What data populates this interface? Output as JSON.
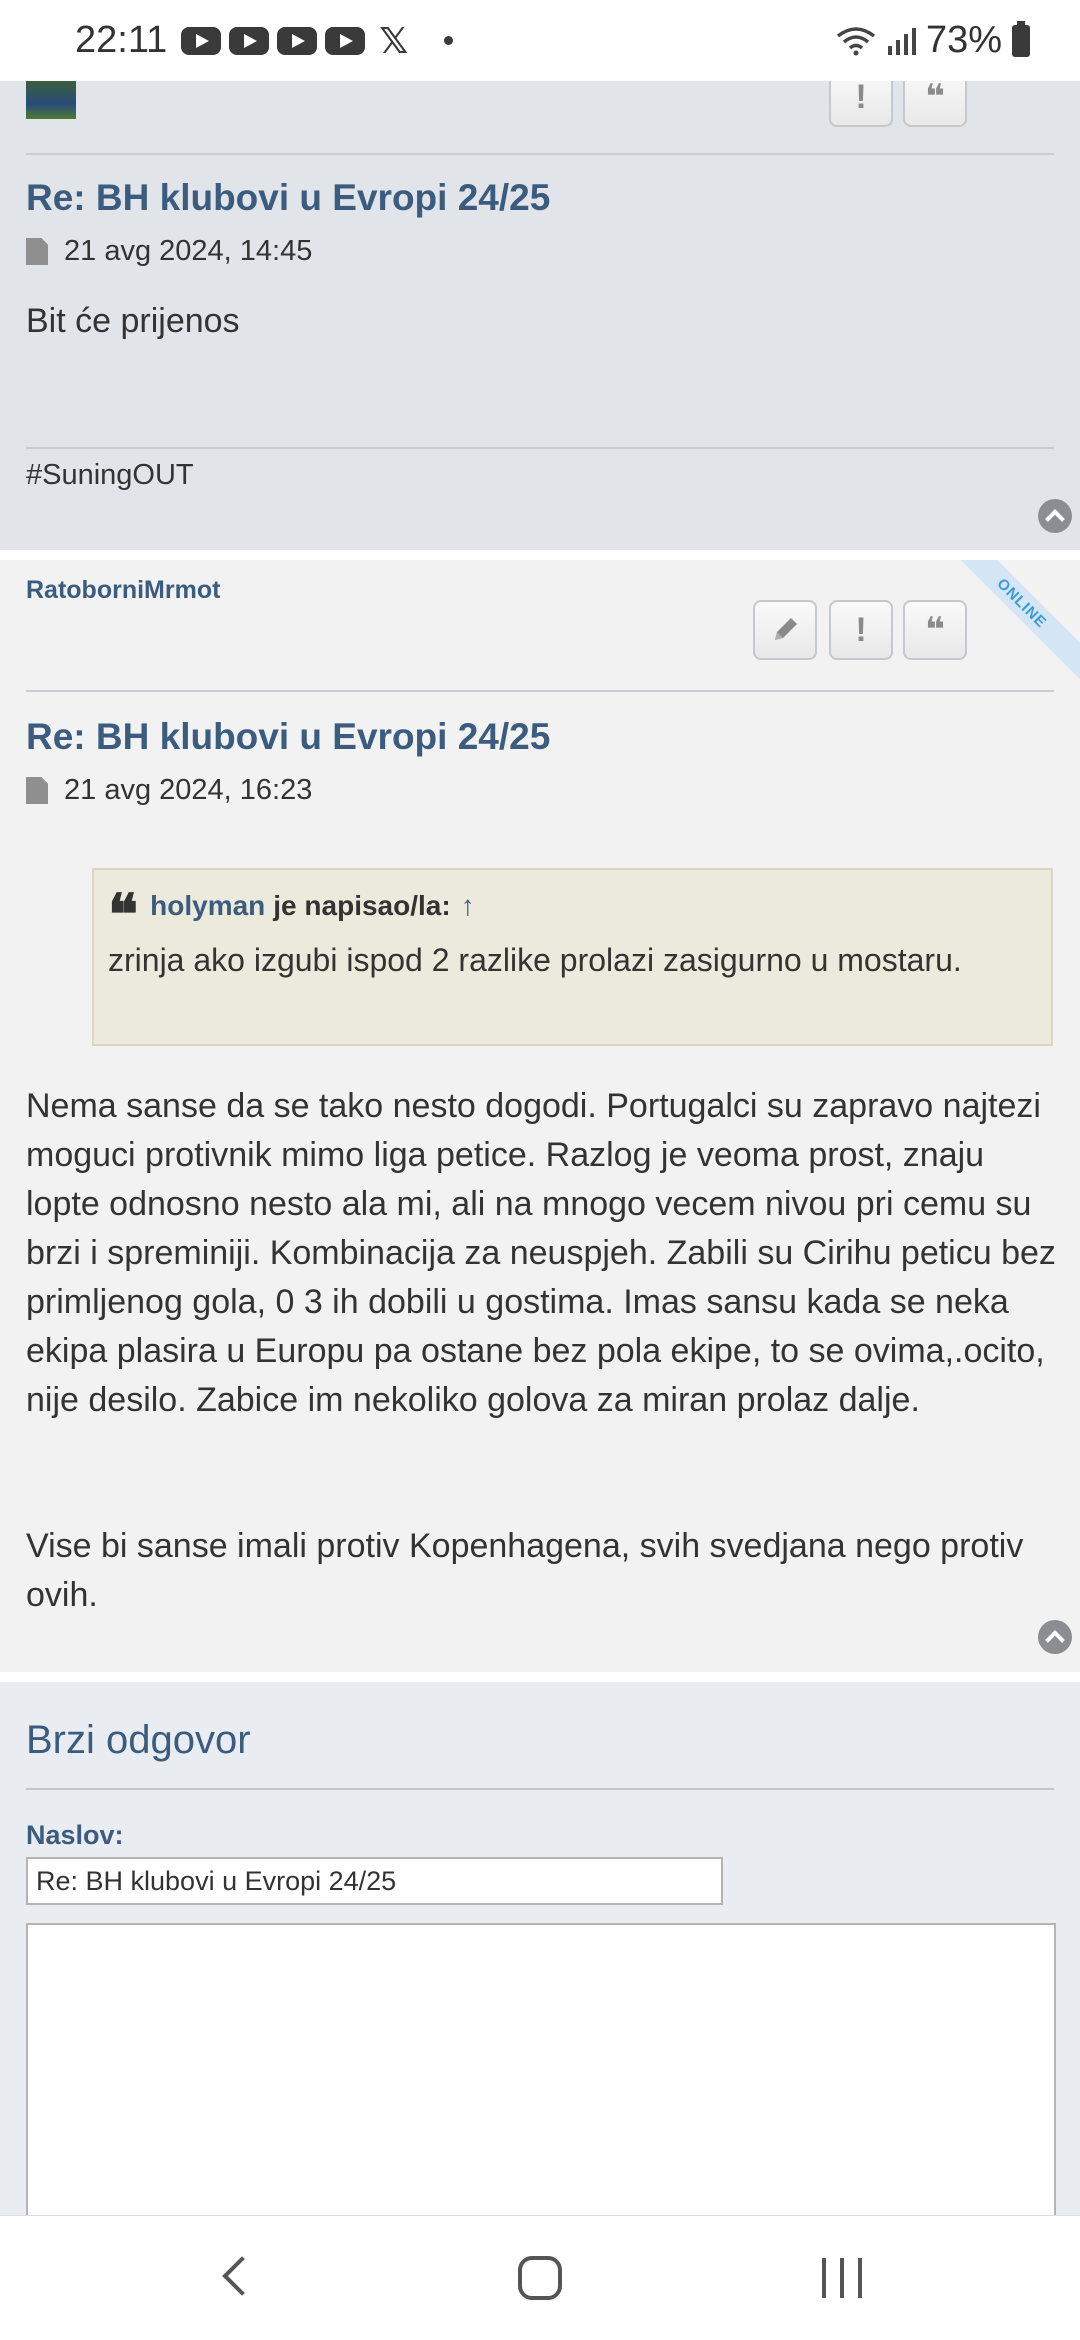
{
  "status_bar": {
    "time": "22:11",
    "apps": [
      "youtube-icon",
      "youtube-icon",
      "youtube-icon",
      "youtube-icon",
      "x-icon"
    ],
    "battery": "73%"
  },
  "post1": {
    "title": "Re: BH klubovi u Evropi 24/25",
    "date": "21 avg 2024, 14:45",
    "content": "Bit će prijenos",
    "signature": "#SuningOUT"
  },
  "post2": {
    "username": "RatoborniMrmot",
    "online_label": "ONLINE",
    "title": "Re: BH klubovi u Evropi 24/25",
    "date": "21 avg 2024, 16:23",
    "quote": {
      "author": "holyman",
      "said": "je napisao/la:",
      "arrow": "↑",
      "text": "zrinja ako izgubi ispod 2 razlike prolazi zasigurno u mostaru."
    },
    "paragraph1": "Nema sanse da se tako nesto dogodi. Portugalci su zapravo najtezi moguci protivnik mimo liga petice. Razlog je veoma prost, znaju lopte odnosno nesto ala mi, ali na mnogo vecem nivou pri cemu su brzi i spreminiji. Kombinacija za neuspjeh. Zabili su Cirihu peticu bez primljenog gola, 0 3 ih dobili u gostima. Imas sansu kada se neka ekipa plasira u Europu pa ostane bez pola ekipe, to se ovima,.ocito, nije desilo. Zabice im nekoliko golova za miran prolaz dalje.",
    "paragraph2": "Vise bi sanse imali protiv Kopenhagena, svih svedjana nego protiv ovih."
  },
  "quick_reply": {
    "title": "Brzi odgovor",
    "subject_label": "Naslov:",
    "subject_value": "Re: BH klubovi u Evropi 24/25"
  },
  "colors": {
    "link": "#3b5c7e",
    "post_bg_alt": "#e1e4e8",
    "post_bg": "#f2f2f2",
    "quote_bg": "#ebeadd"
  }
}
